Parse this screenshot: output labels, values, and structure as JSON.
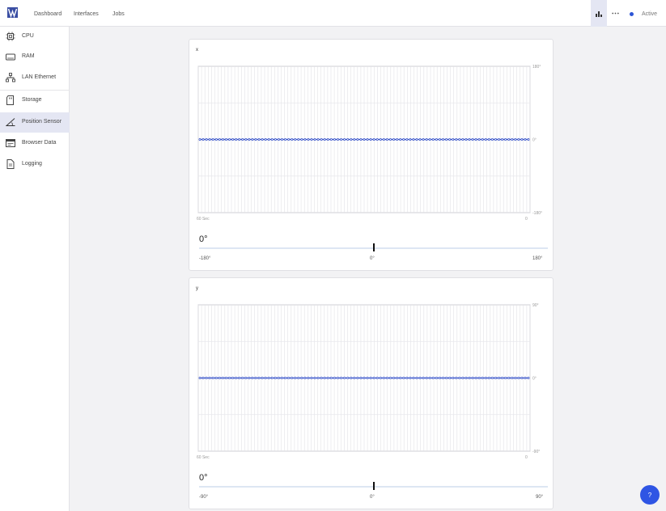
{
  "colors": {
    "accent": "#2d55d6",
    "series": "#3450c8",
    "help": "#2f55e4",
    "active_bg": "#e4e6f3"
  },
  "nav": [
    {
      "label": "Dashboard"
    },
    {
      "label": "Interfaces"
    },
    {
      "label": "Jobs"
    }
  ],
  "toolbar": {
    "chart_icon": "bar-chart-icon",
    "more_icon": "more-horizontal-icon",
    "status_label": "Active"
  },
  "sidebar": {
    "items": [
      {
        "label": "CPU",
        "icon": "cpu-icon"
      },
      {
        "label": "RAM",
        "icon": "ram-icon"
      },
      {
        "label": "LAN Ethernet",
        "icon": "network-icon"
      },
      {
        "label": "Storage",
        "icon": "sd-card-icon"
      },
      {
        "label": "Position Sensor",
        "icon": "angle-icon",
        "active": true
      },
      {
        "label": "Browser Data",
        "icon": "browser-icon"
      },
      {
        "label": "Logging",
        "icon": "document-icon"
      }
    ]
  },
  "cards": [
    {
      "title": "x",
      "value": "0°",
      "slider": {
        "min_label": "-180°",
        "mid_label": "0°",
        "max_label": "180°",
        "value": 0.5
      },
      "axis": {
        "x_start": "60 Sec",
        "x_end": "0"
      }
    },
    {
      "title": "y",
      "value": "0°",
      "slider": {
        "min_label": "-90°",
        "mid_label": "0°",
        "max_label": "90°",
        "value": 0.5
      },
      "axis": {
        "x_start": "60 Sec",
        "x_end": "0"
      }
    }
  ],
  "chart_data": [
    {
      "type": "line",
      "title": "x",
      "xlabel": "",
      "ylabel": "",
      "x_tick_labels": [
        "60 Sec",
        "0"
      ],
      "y_tick_labels": [
        "180°",
        "0°",
        "-180°"
      ],
      "ylim": [
        -180,
        180
      ],
      "grid": true,
      "series": [
        {
          "values": [
            0,
            0,
            0,
            0,
            0,
            0,
            0,
            0,
            0,
            0,
            0,
            0,
            0,
            0,
            0,
            0,
            0,
            0,
            0,
            0,
            0,
            0,
            0,
            0,
            0,
            0,
            0,
            0,
            0,
            0,
            0,
            0,
            0,
            0,
            0,
            0,
            0,
            0,
            0,
            0,
            0,
            0,
            0,
            0,
            0,
            0,
            0,
            0,
            0,
            0,
            0,
            0,
            0,
            0,
            0,
            0,
            0,
            0,
            0,
            0,
            0,
            0,
            0,
            0,
            0,
            0,
            0,
            0,
            0,
            0,
            0,
            0,
            0,
            0,
            0,
            0,
            0,
            0,
            0,
            0,
            0,
            0,
            0,
            0,
            0,
            0,
            0,
            0,
            0,
            0,
            0,
            0,
            0,
            0,
            0,
            0,
            0,
            0,
            0,
            0,
            0
          ]
        }
      ]
    },
    {
      "type": "line",
      "title": "y",
      "xlabel": "",
      "ylabel": "",
      "x_tick_labels": [
        "60 Sec",
        "0"
      ],
      "y_tick_labels": [
        "90°",
        "0°",
        "-90°"
      ],
      "ylim": [
        -90,
        90
      ],
      "grid": true,
      "series": [
        {
          "values": [
            0,
            0,
            0,
            0,
            0,
            0,
            0,
            0,
            0,
            0,
            0,
            0,
            0,
            0,
            0,
            0,
            0,
            0,
            0,
            0,
            0,
            0,
            0,
            0,
            0,
            0,
            0,
            0,
            0,
            0,
            0,
            0,
            0,
            0,
            0,
            0,
            0,
            0,
            0,
            0,
            0,
            0,
            0,
            0,
            0,
            0,
            0,
            0,
            0,
            0,
            0,
            0,
            0,
            0,
            0,
            0,
            0,
            0,
            0,
            0,
            0,
            0,
            0,
            0,
            0,
            0,
            0,
            0,
            0,
            0,
            0,
            0,
            0,
            0,
            0,
            0,
            0,
            0,
            0,
            0,
            0,
            0,
            0,
            0,
            0,
            0,
            0,
            0,
            0,
            0,
            0,
            0,
            0,
            0,
            0,
            0,
            0,
            0,
            0,
            0,
            0
          ]
        }
      ]
    }
  ]
}
